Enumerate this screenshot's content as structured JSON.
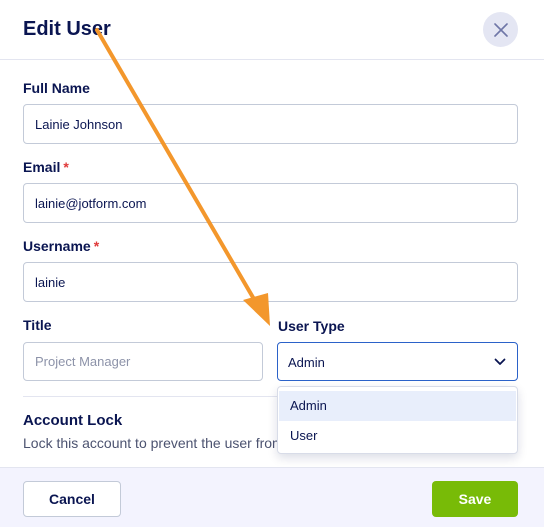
{
  "dialog": {
    "title": "Edit User",
    "close_icon": "close-icon"
  },
  "form": {
    "full_name": {
      "label": "Full Name",
      "value": "Lainie Johnson"
    },
    "email": {
      "label": "Email",
      "required_mark": "*",
      "value": "lainie@jotform.com"
    },
    "username": {
      "label": "Username",
      "required_mark": "*",
      "value": "lainie"
    },
    "title": {
      "label": "Title",
      "value": "",
      "placeholder": "Project Manager"
    },
    "user_type": {
      "label": "User Type",
      "selected": "Admin",
      "chevron_icon": "chevron-down-icon",
      "options": [
        "Admin",
        "User"
      ]
    }
  },
  "account_lock": {
    "title": "Account Lock",
    "description": "Lock this account to prevent the user from"
  },
  "footer": {
    "cancel_label": "Cancel",
    "save_label": "Save"
  },
  "annotation": {
    "arrow_color": "#f3972c"
  },
  "colors": {
    "save_button": "#78bb07",
    "text": "#0a1551",
    "select_border": "#2b62c9",
    "selected_option_bg": "#e8eefb",
    "required": "#e03a3a"
  }
}
